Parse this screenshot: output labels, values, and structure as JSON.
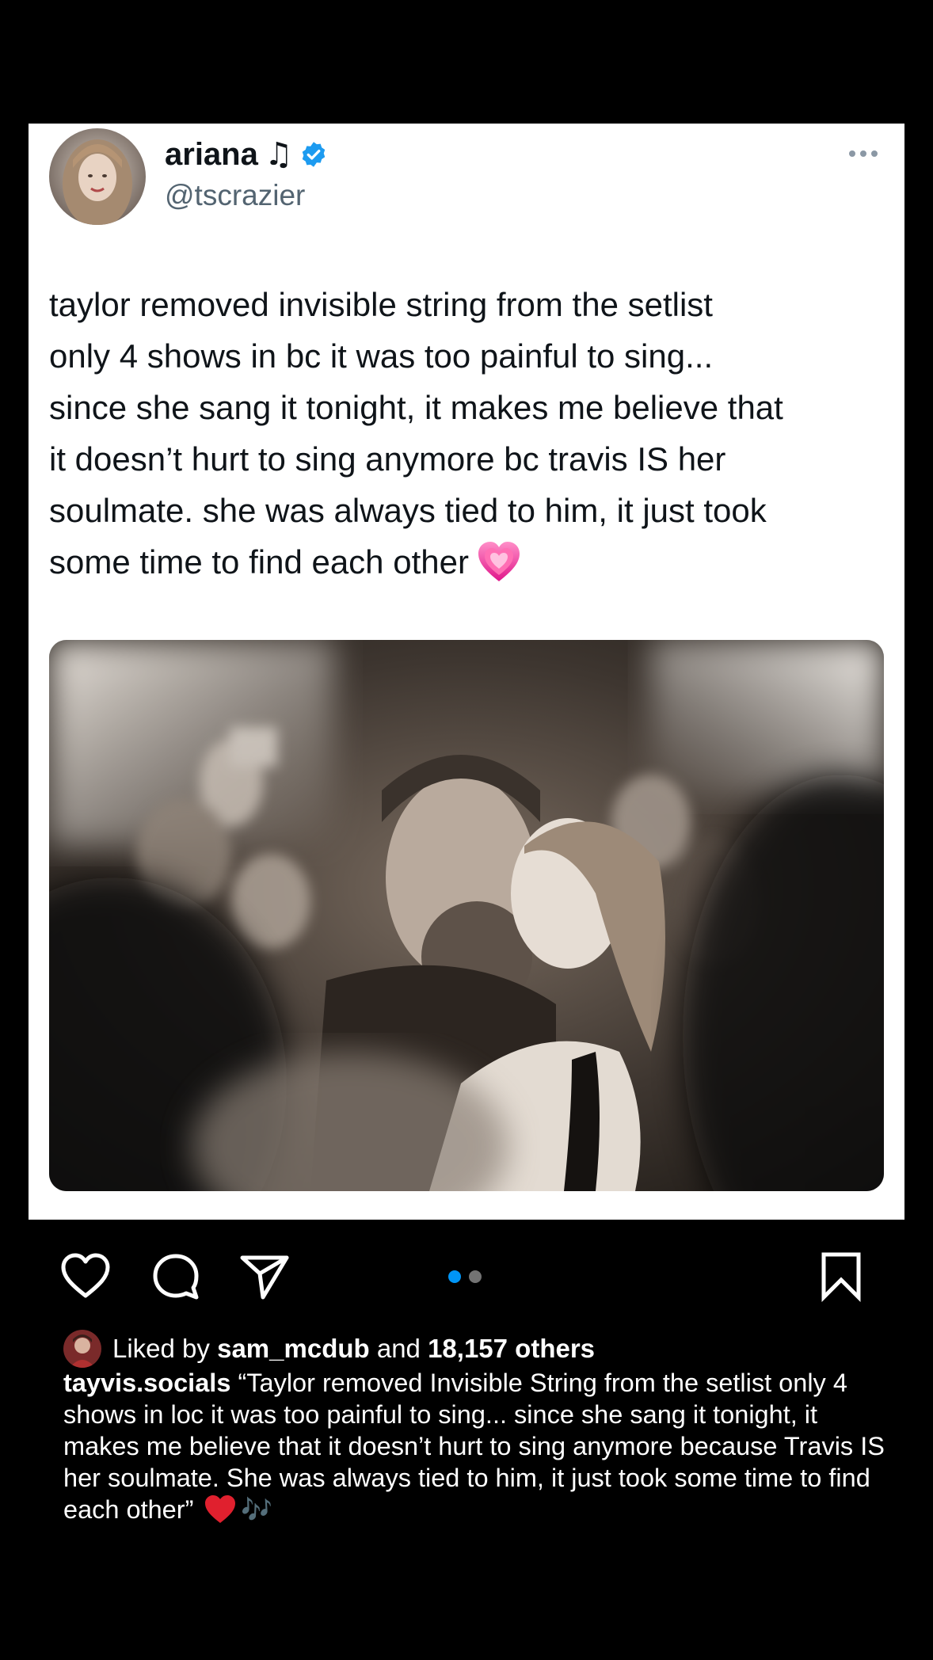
{
  "tweet": {
    "display_name": "ariana",
    "name_glyph": "♫",
    "handle": "@tscrazier",
    "text": "taylor removed invisible string from the setlist\nonly 4 shows in bc it was too painful to sing...\nsince she sang it tonight, it makes me believe that\nit doesn’t hurt to sing anymore bc travis IS her\nsoulmate. she was always tied to him, it just took\nsome time to find each other",
    "emoji_icon": "growing-heart-icon",
    "verified_color": "#1d9bf0"
  },
  "post": {
    "carousel": {
      "active_color": "#0095f6",
      "inactive_color": "#737373",
      "current_index": 1,
      "total": 2
    },
    "likes": {
      "prefix": "Liked by",
      "user": "sam_mcdub",
      "and": "and",
      "count": "18,157 others"
    },
    "caption": {
      "username": "tayvis.socials",
      "text": "“Taylor removed Invisible String from the setlist only 4 shows in loc it was too painful to sing... since she sang it tonight, it makes me believe that it doesn’t hurt to sing anymore because Travis IS her soulmate. She was always tied to him, it just took some time to find each other”",
      "notes_glyph": "🎶"
    }
  },
  "icons": {
    "like": "heart-outline-icon",
    "comment": "comment-bubble-icon",
    "share": "paper-plane-icon",
    "save": "bookmark-icon",
    "more": "more-dots-icon"
  }
}
